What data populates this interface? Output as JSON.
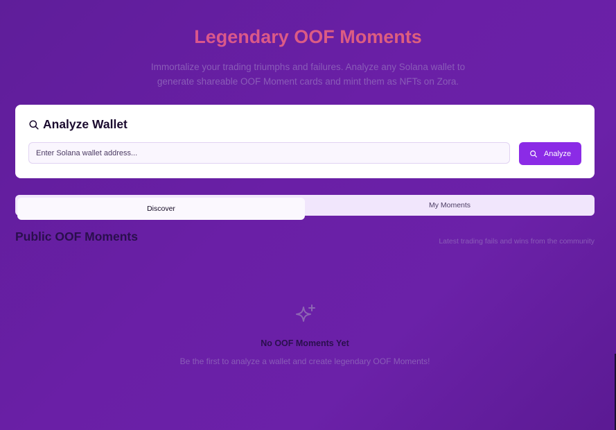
{
  "hero": {
    "title": "Legendary OOF Moments",
    "subtitle_line1": "Immortalize your trading triumphs and failures. Analyze any Solana wallet to",
    "subtitle_line2": "generate shareable OOF Moment cards and mint them as NFTs on Zora."
  },
  "analyze": {
    "title": "Analyze Wallet",
    "icon": "search-icon",
    "input_placeholder": "Enter Solana wallet address...",
    "input_value": "",
    "button_label": "Analyze"
  },
  "tabs": [
    {
      "label": "Discover",
      "selected": true
    },
    {
      "label": "My Moments",
      "selected": false
    }
  ],
  "section": {
    "title": "Public OOF Moments",
    "subtitle": "Latest trading fails and wins from the community"
  },
  "empty_state": {
    "icon": "sparkles-icon",
    "title": "No OOF Moments Yet",
    "subtitle": "Be the first to analyze a wallet and create legendary OOF Moments!"
  },
  "colors": {
    "background": "#6a1fa6",
    "accent": "#8b2be6",
    "title_gradient_start": "#d6509a",
    "title_gradient_end": "#e2666f"
  }
}
